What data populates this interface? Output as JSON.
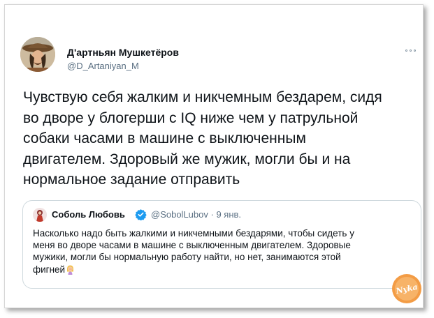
{
  "author": {
    "name": "Д'артньян Мушкетёров",
    "handle": "@D_Artaniyan_M"
  },
  "tweet": {
    "lines": [
      "Чувствую себя жалким и никчемным бездарем, сидя",
      "во дворе у блогерши с IQ ниже чем у патрульной",
      "собаки часами в машине с выключенным",
      "двигателем. Здоровый же мужик, могли бы и на",
      "нормальное задание отправить"
    ]
  },
  "quote": {
    "name": "Соболь Любовь",
    "handle": "@SobolLubov",
    "separator": "·",
    "date": "9 янв.",
    "lines": [
      "Насколько надо быть жалкими и никчемными бездарями, чтобы сидеть у",
      "меня во дворе часами в машине с выключенным двигателем. Здоровые",
      "мужики, могли бы нормальную работу найти, но нет, занимаются этой",
      "фигней"
    ]
  },
  "watermark": {
    "text": "Nyka"
  },
  "icons": {
    "more": "more-icon",
    "verified": "verified-badge-icon",
    "emoji": "woman-facepalming-emoji"
  },
  "colors": {
    "text": "#0f1419",
    "secondary": "#5b7083",
    "verified": "#1d9bf0",
    "border": "#cfd9de"
  }
}
